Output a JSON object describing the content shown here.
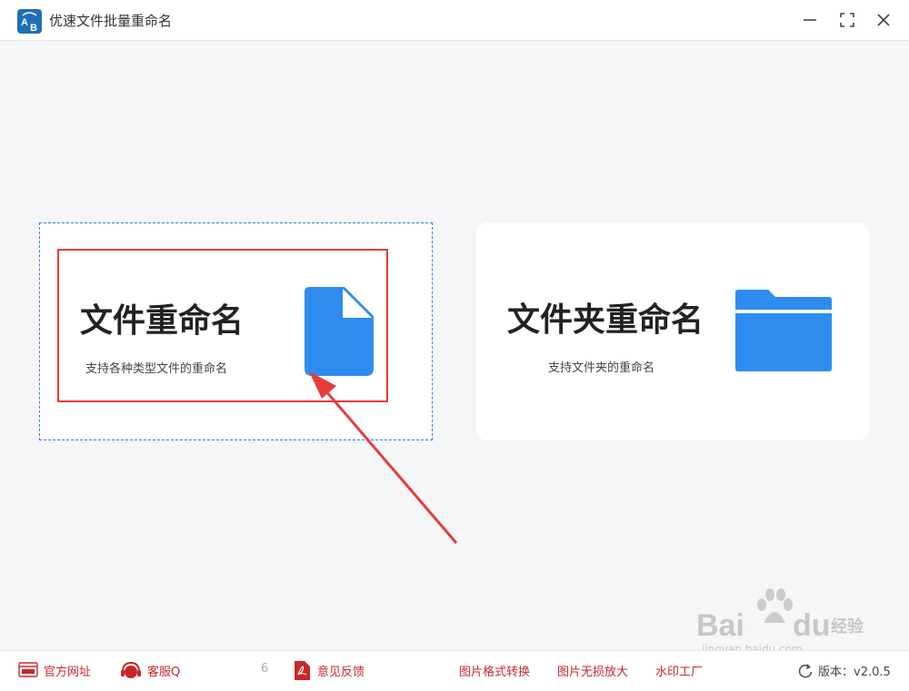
{
  "window": {
    "title": "优速文件批量重命名",
    "app_icon_letters": [
      "A",
      "B"
    ]
  },
  "cards": {
    "file": {
      "title": "文件重命名",
      "subtitle": "支持各种类型文件的重命名",
      "icon": "file-icon"
    },
    "folder": {
      "title": "文件夹重命名",
      "subtitle": "支持文件夹的重命名",
      "icon": "folder-icon"
    }
  },
  "footer": {
    "website": "官方网址",
    "support": "客服Q",
    "support_tail": "6",
    "feedback": "意见反馈",
    "image_convert": "图片格式转换",
    "image_enlarge": "图片无损放大",
    "watermark_factory": "水印工厂",
    "version_label": "版本：",
    "version_value": "v2.0.5"
  },
  "watermark": {
    "brand": "Bai",
    "brand_tail": "du",
    "brand_cn": "经验",
    "url": "jingyan.baidu.com"
  },
  "colors": {
    "accent_blue": "#2f8cef",
    "highlight_red": "#e63b3b",
    "footer_red": "#c8262b",
    "background": "#f5f6f8"
  }
}
